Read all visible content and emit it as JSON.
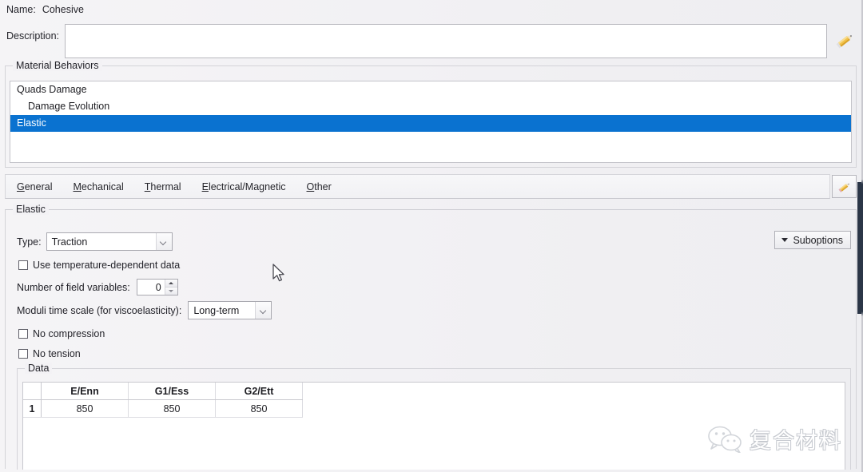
{
  "dialog": {
    "name_label": "Name:",
    "name_value": "Cohesive",
    "description_label": "Description:",
    "description_value": "",
    "description_placeholder": ""
  },
  "behaviors": {
    "group_title": "Material Behaviors",
    "items": [
      {
        "label": "Quads Damage",
        "indent": false,
        "selected": false
      },
      {
        "label": "Damage Evolution",
        "indent": true,
        "selected": false
      },
      {
        "label": "Elastic",
        "indent": false,
        "selected": true
      }
    ],
    "selected_color": "#0a72d0"
  },
  "tabs": [
    {
      "mnemonic": "G",
      "rest": "eneral"
    },
    {
      "mnemonic": "M",
      "rest": "echanical"
    },
    {
      "mnemonic": "T",
      "rest": "hermal"
    },
    {
      "mnemonic": "E",
      "rest": "lectrical/Magnetic"
    },
    {
      "mnemonic": "O",
      "rest": "ther"
    }
  ],
  "elastic": {
    "group_title": "Elastic",
    "type_label": "Type:",
    "type_value": "Traction",
    "use_temperature_label": "Use temperature-dependent data",
    "use_temperature_checked": false,
    "field_vars_label": "Number of field variables:",
    "field_vars_value": "0",
    "moduli_label": "Moduli time scale (for viscoelasticity):",
    "moduli_value": "Long-term",
    "no_compression_label": "No compression",
    "no_compression_checked": false,
    "no_tension_label": "No tension",
    "no_tension_checked": false,
    "suboptions_label": "Suboptions"
  },
  "data_panel": {
    "group_title": "Data",
    "columns": [
      "E/Enn",
      "G1/Ess",
      "G2/Ett"
    ],
    "rows": [
      {
        "index": "1",
        "values": [
          "850",
          "850",
          "850"
        ]
      }
    ]
  },
  "icons": {
    "pencil_description": "pencil-icon",
    "pencil_tabs": "pencil-icon",
    "suboptions_arrow": "chevron-down-icon",
    "combo_arrow": "chevron-down-icon"
  },
  "watermark": {
    "text": "复合材料",
    "logo": "wechat-icon"
  }
}
